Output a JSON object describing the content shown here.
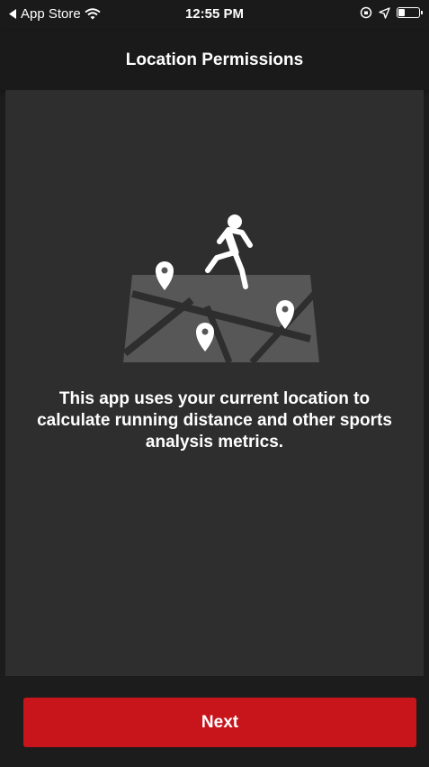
{
  "status_bar": {
    "back_app": "App Store",
    "time": "12:55 PM"
  },
  "nav": {
    "title": "Location Permissions"
  },
  "main": {
    "illustration_icon": "running-person-map-pins",
    "description": "This app uses your current location to calculate running distance and other sports analysis metrics."
  },
  "footer": {
    "next_label": "Next"
  },
  "colors": {
    "accent": "#c8151b",
    "background": "#2e2e2e",
    "bar": "#1a1a1a"
  }
}
